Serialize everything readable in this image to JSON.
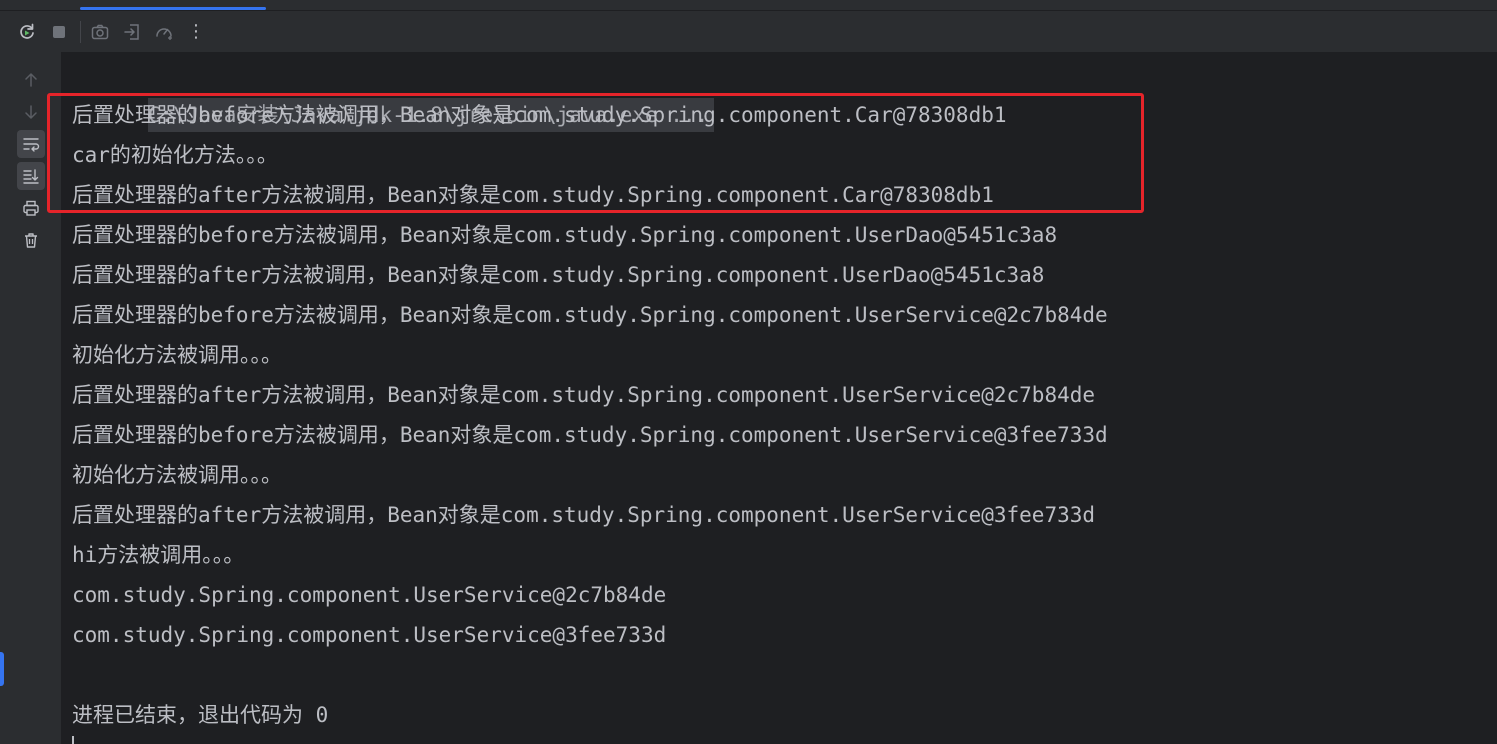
{
  "toolbar": {
    "icons": [
      "rerun-icon",
      "stop-icon",
      "camera-icon",
      "exit-icon",
      "profiler-icon",
      "more-icon"
    ],
    "more_label": "⋮"
  },
  "gutter": {
    "icons": [
      "arrow-up-icon",
      "arrow-down-icon",
      "soft-wrap-icon",
      "scroll-to-end-icon",
      "print-icon",
      "trash-icon"
    ]
  },
  "console": {
    "command": "C:\\Java安装\\Java\\jdk-1.8\\jre\\bin\\java.exe ...",
    "lines": [
      "后置处理器的before方法被调用，Bean对象是com.study.Spring.component.Car@78308db1",
      "car的初始化方法。。。",
      "后置处理器的after方法被调用，Bean对象是com.study.Spring.component.Car@78308db1",
      "后置处理器的before方法被调用，Bean对象是com.study.Spring.component.UserDao@5451c3a8",
      "后置处理器的after方法被调用，Bean对象是com.study.Spring.component.UserDao@5451c3a8",
      "后置处理器的before方法被调用，Bean对象是com.study.Spring.component.UserService@2c7b84de",
      "初始化方法被调用。。。",
      "后置处理器的after方法被调用，Bean对象是com.study.Spring.component.UserService@2c7b84de",
      "后置处理器的before方法被调用，Bean对象是com.study.Spring.component.UserService@3fee733d",
      "初始化方法被调用。。。",
      "后置处理器的after方法被调用，Bean对象是com.study.Spring.component.UserService@3fee733d",
      "hi方法被调用。。。",
      "com.study.Spring.component.UserService@2c7b84de",
      "com.study.Spring.component.UserService@3fee733d",
      "",
      "进程已结束，退出代码为 0"
    ]
  },
  "colors": {
    "background": "#1e1f22",
    "panel": "#2b2d30",
    "text": "#bcbec4",
    "accent": "#3574f0",
    "highlight_border": "#e5242a"
  }
}
